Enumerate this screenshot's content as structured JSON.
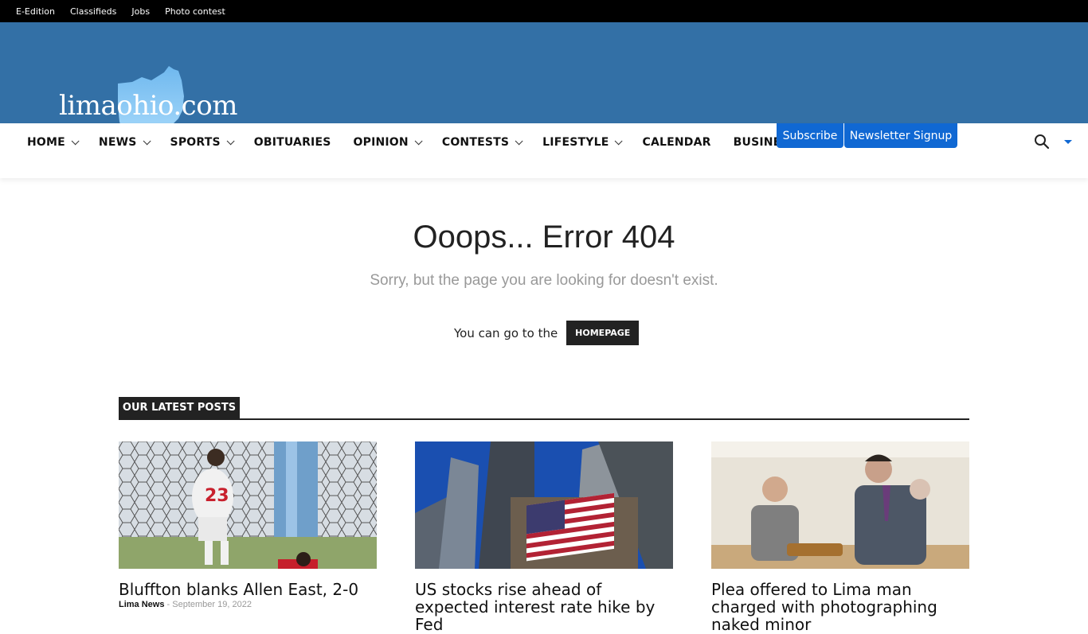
{
  "topbar": {
    "links": [
      "E-Edition",
      "Classifieds",
      "Jobs",
      "Photo contest"
    ]
  },
  "header": {
    "logo_text": "limaohio.com",
    "bg_color": "#3370a6"
  },
  "nav": {
    "items": [
      {
        "label": "HOME",
        "dropdown": true
      },
      {
        "label": "NEWS",
        "dropdown": true
      },
      {
        "label": "SPORTS",
        "dropdown": true
      },
      {
        "label": "OBITUARIES",
        "dropdown": false
      },
      {
        "label": "OPINION",
        "dropdown": true
      },
      {
        "label": "CONTESTS",
        "dropdown": true
      },
      {
        "label": "LIFESTYLE",
        "dropdown": true
      },
      {
        "label": "CALENDAR",
        "dropdown": false
      },
      {
        "label": "BUSINESSES",
        "dropdown": true
      }
    ],
    "subscribe_label": "Subscribe",
    "newsletter_label": "Newsletter Signup",
    "accent_color": "#1068d3"
  },
  "error": {
    "title": "Ooops... Error 404",
    "subtitle": "Sorry, but the page you are looking for doesn't exist.",
    "goto_text": "You can go to the",
    "homepage_label": "HOMEPAGE"
  },
  "latest": {
    "heading": "OUR LATEST POSTS",
    "posts": [
      {
        "title": "Bluffton blanks Allen East, 2-0",
        "author": "Lima News",
        "date": "September 19, 2022"
      },
      {
        "title": "US stocks rise ahead of expected interest rate hike by Fed",
        "author": "",
        "date": ""
      },
      {
        "title": "Plea offered to Lima man charged with photographing naked minor",
        "author": "",
        "date": ""
      }
    ]
  }
}
